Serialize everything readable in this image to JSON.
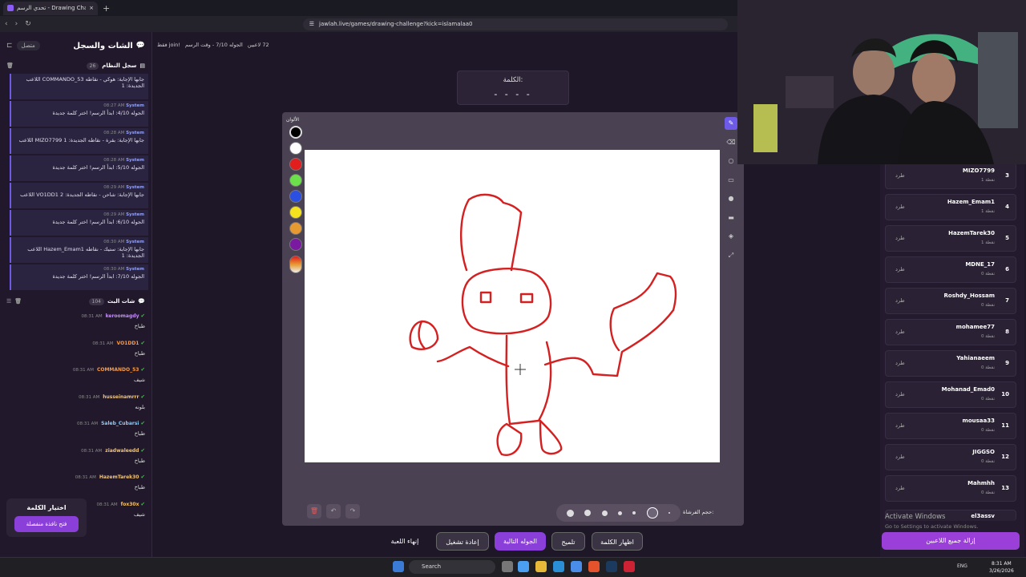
{
  "browser": {
    "tab_title": "تحدي الرسم - Drawing Challenge",
    "new_tab": "+",
    "url": "jawlah.live/games/drawing-challenge?kick=islamalaa0"
  },
  "left_panel": {
    "title": "الشات والسجل",
    "status": "متصل",
    "system_log": {
      "title": "سجل النظام",
      "count": "26"
    },
    "system_messages": [
      {
        "who": "",
        "time": "",
        "text": "اللاعب COMMANDO_53 جابها الإجابة: هوكي - نقاطه الجديدة: 1"
      },
      {
        "who": "System",
        "time": "08:27 AM",
        "text": "الجوله 4/10: ابدأ الرسم! اختر كلمة جديدة"
      },
      {
        "who": "System",
        "time": "08:28 AM",
        "text": "اللاعب MIZO7799 جابها الإجابة: بقرة - نقاطه الجديدة: 1"
      },
      {
        "who": "System",
        "time": "08:28 AM",
        "text": "الجوله 5/10: ابدأ الرسم! اختر كلمة جديدة"
      },
      {
        "who": "System",
        "time": "08:29 AM",
        "text": "اللاعب VO1DD1 جابها الإجابة: شاحن - نقاطه الجديدة: 2"
      },
      {
        "who": "System",
        "time": "08:29 AM",
        "text": "الجوله 6/10: ابدأ الرسم! اختر كلمة جديدة"
      },
      {
        "who": "System",
        "time": "08:30 AM",
        "text": "اللاعب Hazem_Emam1 جابها الإجابة: ستيك - نقاطه الجديدة: 1"
      },
      {
        "who": "System",
        "time": "08:30 AM",
        "text": "الجوله 7/10: ابدأ الرسم! اختر كلمة جديدة"
      }
    ],
    "live_chat": {
      "title": "شات البث",
      "count": "104"
    },
    "chat_messages": [
      {
        "who": "keroomagdy",
        "time": "08:31 AM",
        "text": "طباخ",
        "color": "#c58bff"
      },
      {
        "who": "VO1DD1",
        "time": "08:31 AM",
        "text": "طباخ",
        "color": "#ff9a3c"
      },
      {
        "who": "COMMANDO_53",
        "time": "08:31 AM",
        "text": "شيف",
        "color": "#ff9a3c"
      },
      {
        "who": "husseinamrrr",
        "time": "08:31 AM",
        "text": "بلونه",
        "color": "#f5c36b"
      },
      {
        "who": "Saleb_Cubarsi",
        "time": "08:31 AM",
        "text": "طباخ",
        "color": "#7fd0ff"
      },
      {
        "who": "ziadwaleedd",
        "time": "08:31 AM",
        "text": "طباخ",
        "color": "#f5c36b"
      },
      {
        "who": "HazemTarek30",
        "time": "08:31 AM",
        "text": "طباخ",
        "color": "#f5c36b"
      },
      {
        "who": "fox30x",
        "time": "08:31 AM",
        "text": "شيف",
        "color": "#f5c36b"
      }
    ],
    "word_picker": {
      "title": "اختيار الكلمة",
      "button": "فتح نافذة منفصلة"
    }
  },
  "game_header": {
    "players": "72 لاعبين",
    "round": "الجوله 7/10 - وقت الرسم",
    "join": "!join فقط"
  },
  "word_box": {
    "label": "الكلمة:",
    "dashes": "- - - -"
  },
  "canvas": {
    "colors_label": "الألوان",
    "colors": [
      "#000000",
      "#ffffff",
      "#e11d1d",
      "#6be04a",
      "#2b4fe0",
      "#f3e21d",
      "#e79a32",
      "#7a1aa0"
    ],
    "tool_icons": [
      "pen-icon",
      "eraser-icon",
      "circle-icon",
      "rect-icon",
      "fill-icon",
      "line-icon",
      "bucket-icon",
      "expand-icon"
    ],
    "brush_label": "حجم الفرشاة:"
  },
  "buttons": {
    "end": "إنهاء اللعبة",
    "replay": "إعادة تشغيل",
    "next_round": "الجوله التالية",
    "hint": "تلميح",
    "reveal": "اظهار الكلمة",
    "remove_all": "إزالة جميع اللاعبين"
  },
  "players": [
    {
      "rank": "3",
      "name": "MIZO7799",
      "pts": "1 نقطة",
      "kick": "طرد"
    },
    {
      "rank": "4",
      "name": "Hazem_Emam1",
      "pts": "1 نقطة",
      "kick": "طرد"
    },
    {
      "rank": "5",
      "name": "HazemTarek30",
      "pts": "1 نقطة",
      "kick": "طرد"
    },
    {
      "rank": "6",
      "name": "MDNE_17",
      "pts": "0 نقطة",
      "kick": "طرد"
    },
    {
      "rank": "7",
      "name": "Roshdy_Hossam",
      "pts": "0 نقطة",
      "kick": "طرد"
    },
    {
      "rank": "8",
      "name": "mohamee77",
      "pts": "0 نقطة",
      "kick": "طرد"
    },
    {
      "rank": "9",
      "name": "Yahianaeem",
      "pts": "0 نقطة",
      "kick": "طرد"
    },
    {
      "rank": "10",
      "name": "Mohanad_Emad0",
      "pts": "0 نقطة",
      "kick": "طرد"
    },
    {
      "rank": "11",
      "name": "mousaa33",
      "pts": "0 نقطة",
      "kick": "طرد"
    },
    {
      "rank": "12",
      "name": "JIGGSO",
      "pts": "0 نقطة",
      "kick": "طرد"
    },
    {
      "rank": "13",
      "name": "Mahmhh",
      "pts": "0 نقطة",
      "kick": "طرد"
    }
  ],
  "windows": {
    "activate": "Activate Windows",
    "activate_sub": "Go to Settings to activate Windows.",
    "partial_player": "el3assv"
  },
  "taskbar": {
    "search": "Search",
    "lang": "ENG",
    "time": "8:31 AM",
    "date": "3/26/2026"
  }
}
